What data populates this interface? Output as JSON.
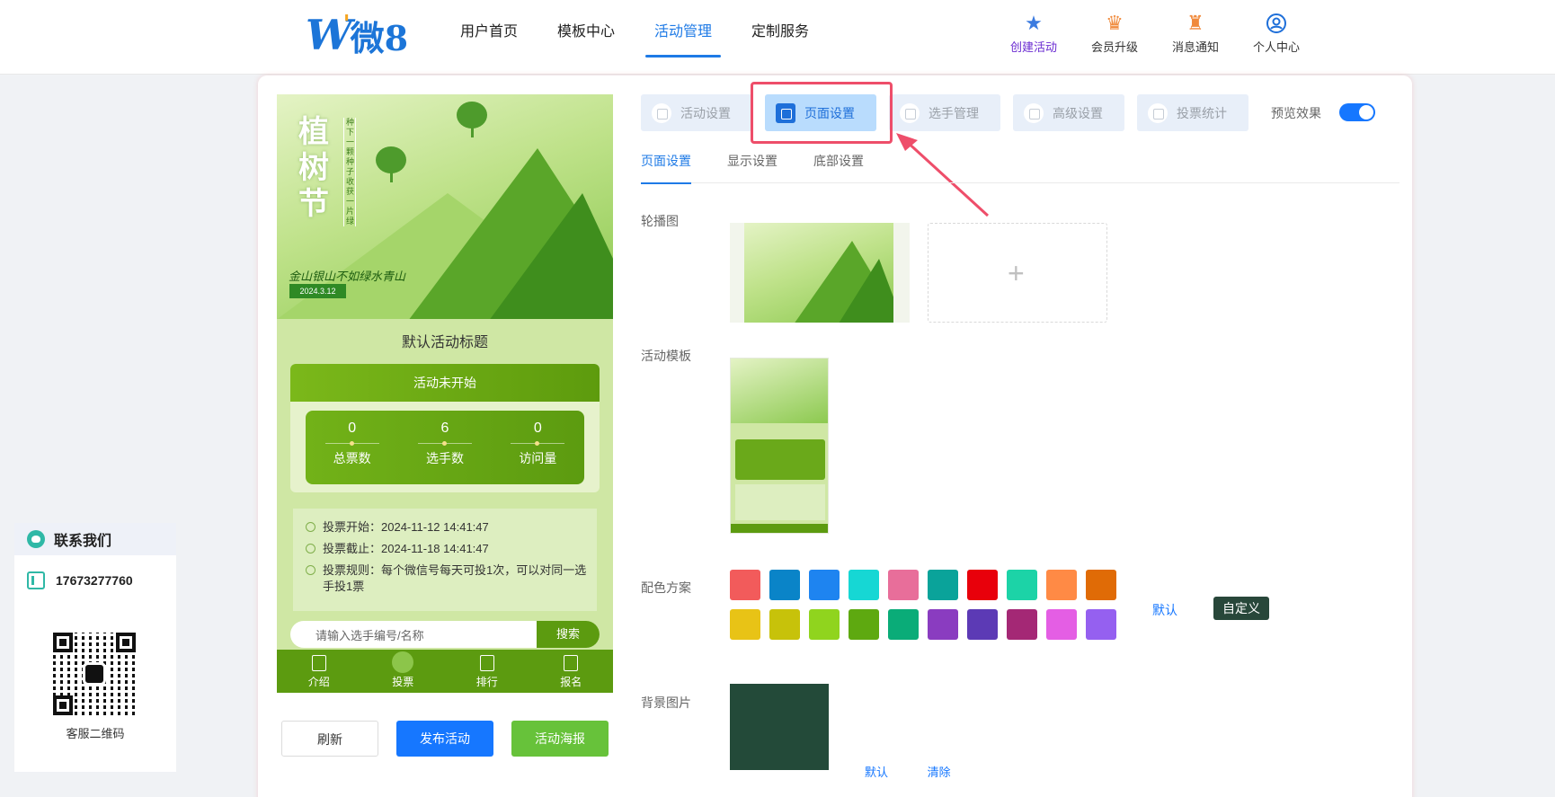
{
  "header": {
    "logo_text": "微8",
    "nav": [
      {
        "label": "用户首页",
        "active": false
      },
      {
        "label": "模板中心",
        "active": false
      },
      {
        "label": "活动管理",
        "active": true
      },
      {
        "label": "定制服务",
        "active": false
      }
    ],
    "actions": [
      {
        "label": "创建活动",
        "icon": "star-icon",
        "color": "#3b7be0"
      },
      {
        "label": "会员升级",
        "icon": "crown-badge-icon",
        "color": "#f08a3c"
      },
      {
        "label": "消息通知",
        "icon": "bell-badge-icon",
        "color": "#f08a3c"
      },
      {
        "label": "个人中心",
        "icon": "user-circle-icon",
        "color": "#1e6fd9"
      }
    ]
  },
  "contact": {
    "title": "联系我们",
    "phone": "17673277760",
    "qr_label": "客服二维码"
  },
  "preview": {
    "banner_title": "植树节",
    "banner_vertical": "种下一颗种子 收获一片绿",
    "banner_slogan": "金山银山不如绿水青山",
    "banner_date": "2024.3.12",
    "activity_title": "默认活动标题",
    "status": "活动未开始",
    "stats": [
      {
        "value": "0",
        "label": "总票数"
      },
      {
        "value": "6",
        "label": "选手数"
      },
      {
        "value": "0",
        "label": "访问量"
      }
    ],
    "info": [
      {
        "text": "投票开始：2024-11-12 14:41:47"
      },
      {
        "text": "投票截止：2024-11-18 14:41:47"
      },
      {
        "text": "投票规则：每个微信号每天可投1次，可以对同一选手投1票"
      }
    ],
    "search_placeholder": "请输入选手编号/名称",
    "search_button": "搜索",
    "tabs": [
      {
        "label": "介绍",
        "active": false
      },
      {
        "label": "投票",
        "active": true
      },
      {
        "label": "排行",
        "active": false
      },
      {
        "label": "报名",
        "active": false
      }
    ]
  },
  "buttons": {
    "refresh": "刷新",
    "publish": "发布活动",
    "poster": "活动海报"
  },
  "steps": [
    {
      "label": "活动设置",
      "active": false
    },
    {
      "label": "页面设置",
      "active": true
    },
    {
      "label": "选手管理",
      "active": false
    },
    {
      "label": "高级设置",
      "active": false
    },
    {
      "label": "投票统计",
      "active": false
    }
  ],
  "preview_toggle": {
    "label": "预览效果",
    "on": true
  },
  "subtabs": [
    {
      "label": "页面设置",
      "active": true
    },
    {
      "label": "显示设置",
      "active": false
    },
    {
      "label": "底部设置",
      "active": false
    }
  ],
  "form": {
    "carousel_label": "轮播图",
    "template_label": "活动模板",
    "color_label": "配色方案",
    "bg_label": "背景图片",
    "upload_symbol": "+",
    "color_default": "默认",
    "color_custom": "自定义",
    "bg_default": "默认",
    "bg_clear": "清除",
    "colors": [
      "#f25b5b",
      "#0a84c8",
      "#1e84f0",
      "#16d7d4",
      "#e86e9a",
      "#0aa39a",
      "#e8000b",
      "#1cd3a7",
      "#ff8a45",
      "#e06b06",
      "#e8c316",
      "#c7c20a",
      "#90d41e",
      "#5ea910",
      "#0aac78",
      "#8a3cc0",
      "#5c3ab5",
      "#a42875",
      "#e45ee4",
      "#9560f0"
    ]
  }
}
